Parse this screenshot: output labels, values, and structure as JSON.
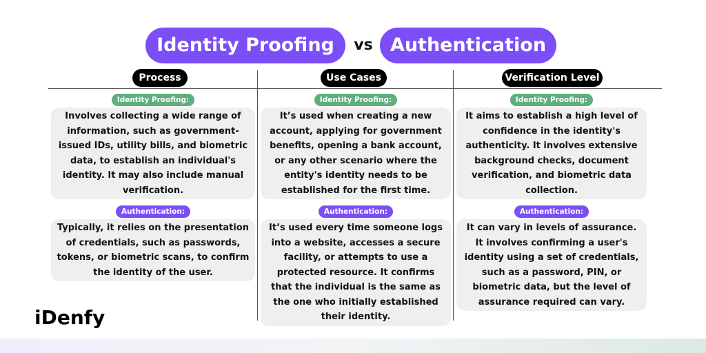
{
  "title": {
    "left": "Identity Proofing",
    "connector": "vs",
    "right": "Authentication"
  },
  "colors": {
    "purple": "#7b4ef6",
    "green": "#5fae7b",
    "header_black": "#000000",
    "text_bg": "#efefef"
  },
  "columns": [
    {
      "heading": "Process",
      "identity_label": "Identity Proofing:",
      "identity_text": "Involves collecting a wide range of information, such as government-issued IDs, utility bills, and biometric data, to establish an individual's identity. It may also include manual verification.",
      "auth_label": "Authentication:",
      "auth_text": "Typically, it relies on the presentation of credentials, such as passwords, tokens, or biometric scans, to confirm the identity of the user."
    },
    {
      "heading": "Use Cases",
      "identity_label": "Identity Proofing:",
      "identity_text": "It’s used when creating a new account, applying for government benefits, opening a bank account, or any other scenario where the entity's identity needs to be established for the first time.",
      "auth_label": "Authentication:",
      "auth_text": "It’s used every time someone logs into a website, accesses a secure facility, or attempts to use a protected resource. It confirms that the individual is the same as the one who initially established their identity."
    },
    {
      "heading": "Verification Level",
      "identity_label": "Identity Proofing:",
      "identity_text": "It aims to establish a high level of confidence in the identity's authenticity. It involves extensive background checks, document verification, and biometric data collection.",
      "auth_label": "Authentication:",
      "auth_text": "It can vary in levels of assurance. It involves confirming a user's identity using a set of credentials, such as a password, PIN, or biometric data, but the level of assurance required can vary."
    }
  ],
  "logo": "iDenfy"
}
